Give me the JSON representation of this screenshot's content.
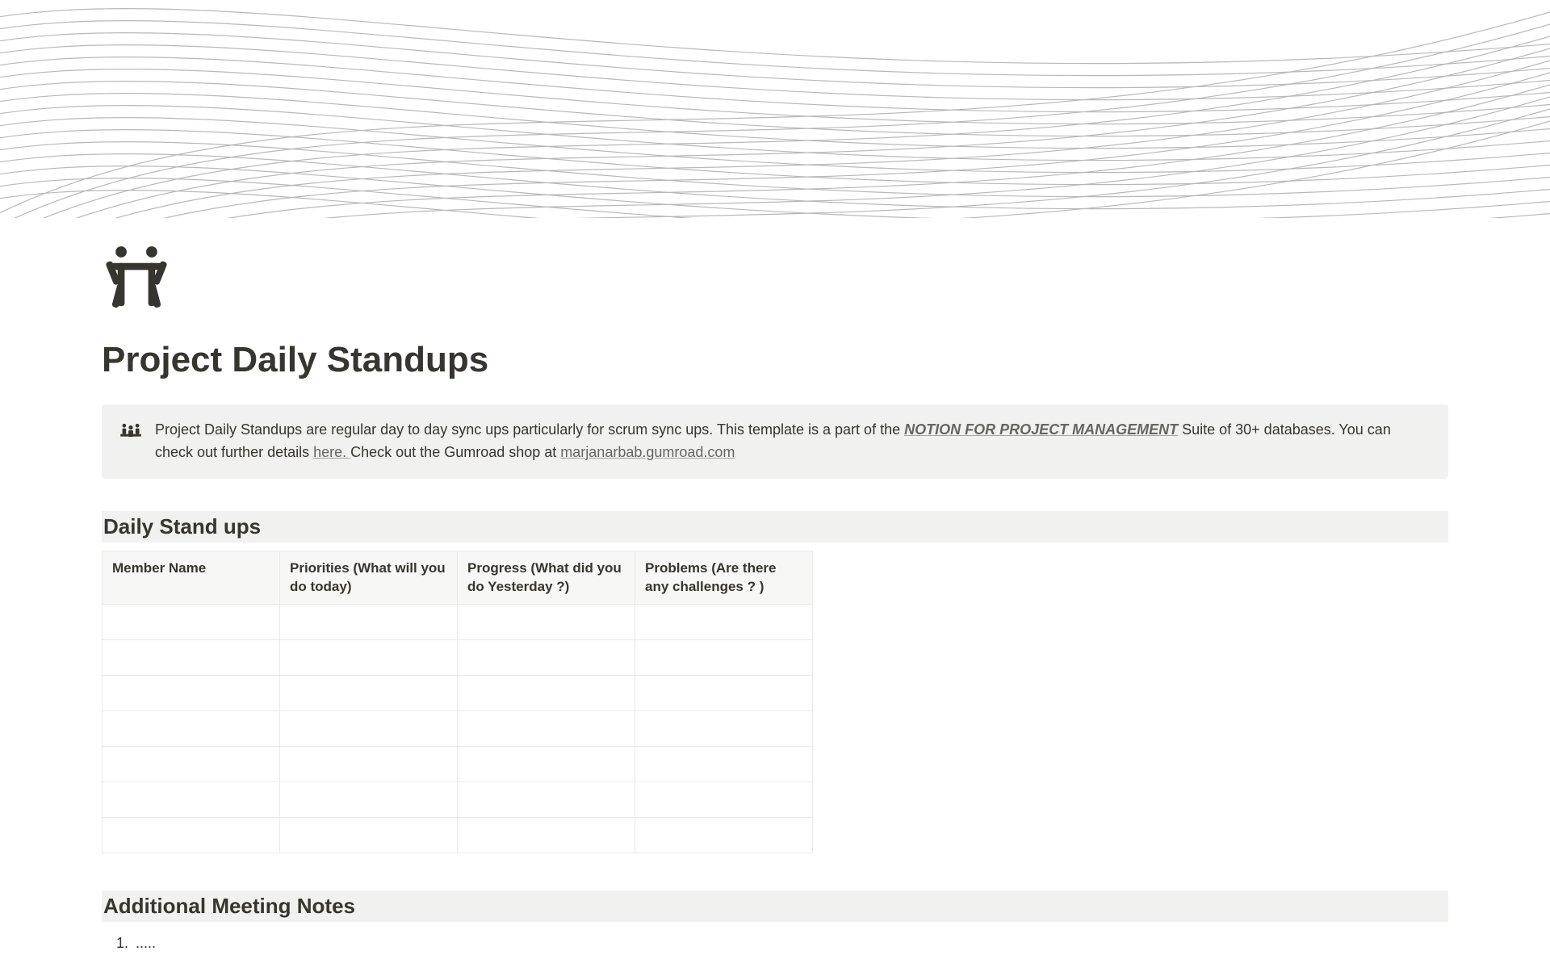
{
  "page": {
    "title": "Project Daily Standups",
    "callout": {
      "text_before": "Project Daily Standups are regular day to day sync ups particularly for scrum sync ups. This template is a part of the ",
      "suite_link": "NOTION FOR PROJECT MANAGEMENT",
      "text_mid": " Suite of 30+ databases. You can check out further details ",
      "here_link": "here. ",
      "text_after": " Check out the  Gumroad shop at ",
      "gumroad_link": "marjanarbab.gumroad.com"
    },
    "section1_heading": "Daily Stand ups",
    "table": {
      "headers": [
        "Member Name",
        "Priorities (What will you do today)",
        "Progress (What did you do Yesterday ?)",
        "Problems (Are there any challenges ? )"
      ],
      "row_count": 7
    },
    "section2_heading": "Additional Meeting Notes",
    "notes": [
      "....."
    ]
  }
}
